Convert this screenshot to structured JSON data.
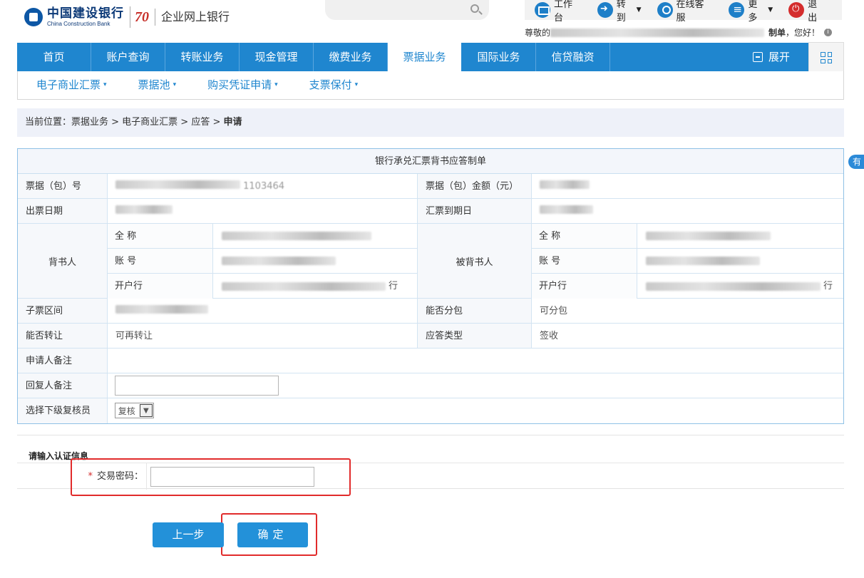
{
  "header": {
    "logo_cn": "中国建设银行",
    "logo_en": "China Construction Bank",
    "logo_70": "70",
    "subtitle": "企业网上银行",
    "tools": [
      {
        "label": "工作台",
        "icon": "monitor-icon"
      },
      {
        "label": "转到",
        "icon": "arrow-icon",
        "dropdown": true
      },
      {
        "label": "在线客服",
        "icon": "person-icon"
      },
      {
        "label": "更多",
        "icon": "list-icon",
        "dropdown": true
      },
      {
        "label": "退出",
        "icon": "power-icon"
      }
    ],
    "greeting_prefix": "尊敬的",
    "greeting_role": "制单",
    "greeting_suffix": "，您好！"
  },
  "mainnav": {
    "items": [
      "首页",
      "账户查询",
      "转账业务",
      "现金管理",
      "缴费业务",
      "票据业务",
      "国际业务",
      "信贷融资"
    ],
    "active_index": 5,
    "expand_label": "展开"
  },
  "subnav": {
    "items": [
      "电子商业汇票",
      "票据池",
      "购买凭证申请",
      "支票保付"
    ]
  },
  "breadcrumb": {
    "prefix": "当前位置：",
    "path": "票据业务 > 电子商业汇票 > 应答 > ",
    "current": "申请"
  },
  "form": {
    "title": "银行承兑汇票背书应答制单",
    "bill_no_label": "票据（包）号",
    "bill_no_value": "1103464",
    "amount_label": "票据（包）金额（元）",
    "issue_date_label": "出票日期",
    "due_date_label": "汇票到期日",
    "endorser_label": "背书人",
    "endorsee_label": "被背书人",
    "name_label": "全 称",
    "account_label": "账 号",
    "bank_label": "开户行",
    "endorser_bank_suffix": "行",
    "endorsee_bank_suffix": "行",
    "sub_range_label": "子票区间",
    "splittable_label": "能否分包",
    "splittable_value": "可分包",
    "transferable_label": "能否转让",
    "transferable_value": "可再转让",
    "response_type_label": "应答类型",
    "response_type_value": "签收",
    "applicant_remark_label": "申请人备注",
    "reply_remark_label": "回复人备注",
    "reviewer_label": "选择下级复核员",
    "reviewer_selected": "复核"
  },
  "auth": {
    "title": "请输入认证信息",
    "required_mark": "*",
    "password_label": "交易密码："
  },
  "buttons": {
    "prev": "上一步",
    "confirm": "确定"
  },
  "side_tab": "有"
}
